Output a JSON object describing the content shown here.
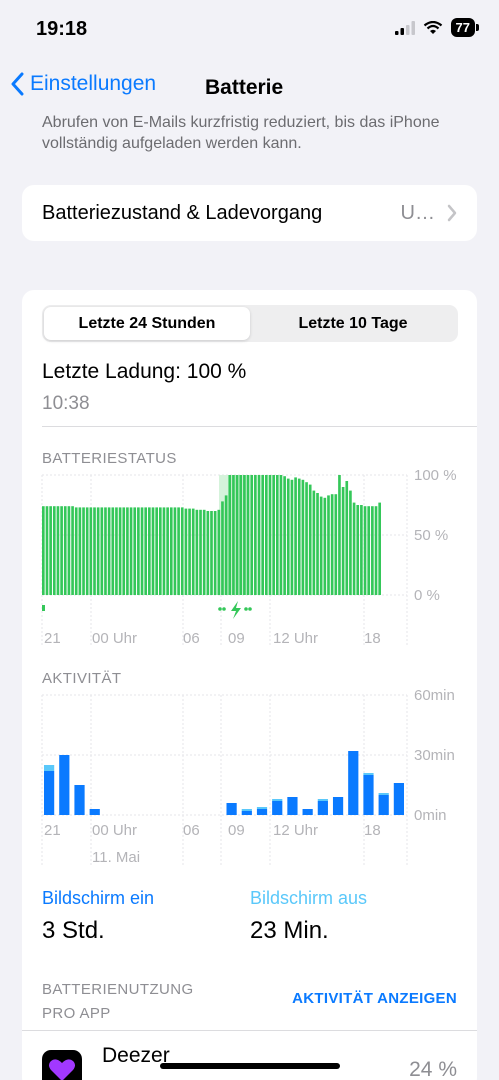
{
  "status_bar": {
    "time": "19:18",
    "battery": "77"
  },
  "nav": {
    "back_label": "Einstellungen",
    "title": "Batterie"
  },
  "faded_text": "Abrufen von E-Mails kurzfristig reduziert, bis das iPhone vollständig aufgeladen werden kann.",
  "battery_health": {
    "label": "Batteriezustand & Ladevorgang",
    "value": "U…"
  },
  "segments": [
    {
      "label": "Letzte 24 Stunden",
      "active": true
    },
    {
      "label": "Letzte 10 Tage",
      "active": false
    }
  ],
  "last_charge": {
    "label": "Letzte Ladung: 100 %",
    "time": "10:38"
  },
  "battery_chart_title": "BATTERIESTATUS",
  "activity_chart_title": "AKTIVITÄT",
  "chart_data": [
    {
      "type": "bar",
      "title": "BATTERIESTATUS",
      "y_ticks": [
        "100 %",
        "50 %",
        "0 %"
      ],
      "ylim": [
        0,
        100
      ],
      "x_ticks": [
        "21",
        "00 Uhr",
        "06",
        "09",
        "12 Uhr",
        "18"
      ],
      "colors": {
        "bar": "#34c759",
        "charging": "#d5f3db"
      },
      "values": [
        74,
        74,
        74,
        74,
        74,
        74,
        74,
        74,
        74,
        73,
        73,
        73,
        73,
        73,
        73,
        73,
        73,
        73,
        73,
        73,
        73,
        73,
        73,
        73,
        73,
        73,
        73,
        73,
        73,
        73,
        73,
        73,
        73,
        73,
        73,
        73,
        73,
        73,
        73,
        72,
        72,
        72,
        71,
        71,
        71,
        70,
        70,
        70,
        71,
        78,
        83,
        100,
        100,
        100,
        100,
        100,
        100,
        100,
        100,
        100,
        100,
        100,
        100,
        100,
        100,
        100,
        99,
        97,
        96,
        98,
        97,
        96,
        94,
        92,
        87,
        85,
        82,
        81,
        83,
        84,
        84,
        100,
        90,
        95,
        87,
        77,
        75,
        75,
        74,
        74,
        74,
        74,
        77
      ]
    },
    {
      "type": "bar",
      "title": "AKTIVITÄT",
      "y_ticks": [
        "60min",
        "30min",
        "0min"
      ],
      "ylim": [
        0,
        60
      ],
      "x_ticks": [
        "21",
        "00 Uhr",
        "06",
        "09",
        "12 Uhr",
        "18"
      ],
      "date_label": "11. Mai",
      "colors": {
        "screen_on": "#0a7aff",
        "screen_off": "#5ac8fa"
      },
      "series": [
        {
          "name": "Bildschirm ein",
          "values": [
            22,
            30,
            15,
            3,
            0,
            0,
            0,
            0,
            0,
            0,
            0,
            0,
            6,
            2,
            3,
            7,
            9,
            3,
            7,
            9,
            32,
            20,
            10,
            16
          ]
        },
        {
          "name": "Bildschirm aus",
          "values": [
            3,
            0,
            0,
            0,
            0,
            0,
            0,
            0,
            0,
            0,
            0,
            0,
            0,
            1,
            1,
            1,
            0,
            0,
            1,
            0,
            0,
            1,
            1,
            0
          ]
        }
      ]
    }
  ],
  "stats": {
    "screen_on_label": "Bildschirm ein",
    "screen_on_value": "3 Std.",
    "screen_off_label": "Bildschirm aus",
    "screen_off_value": "23 Min."
  },
  "usage": {
    "header_line1": "BATTERIENUTZUNG",
    "header_line2": "PRO APP",
    "action": "AKTIVITÄT ANZEIGEN"
  },
  "app": {
    "name": "Deezer",
    "percent": "24 %"
  },
  "colors": {
    "accent": "#0a7aff",
    "battery_green": "#34c759",
    "screen_off_blue": "#5ac8fa"
  }
}
